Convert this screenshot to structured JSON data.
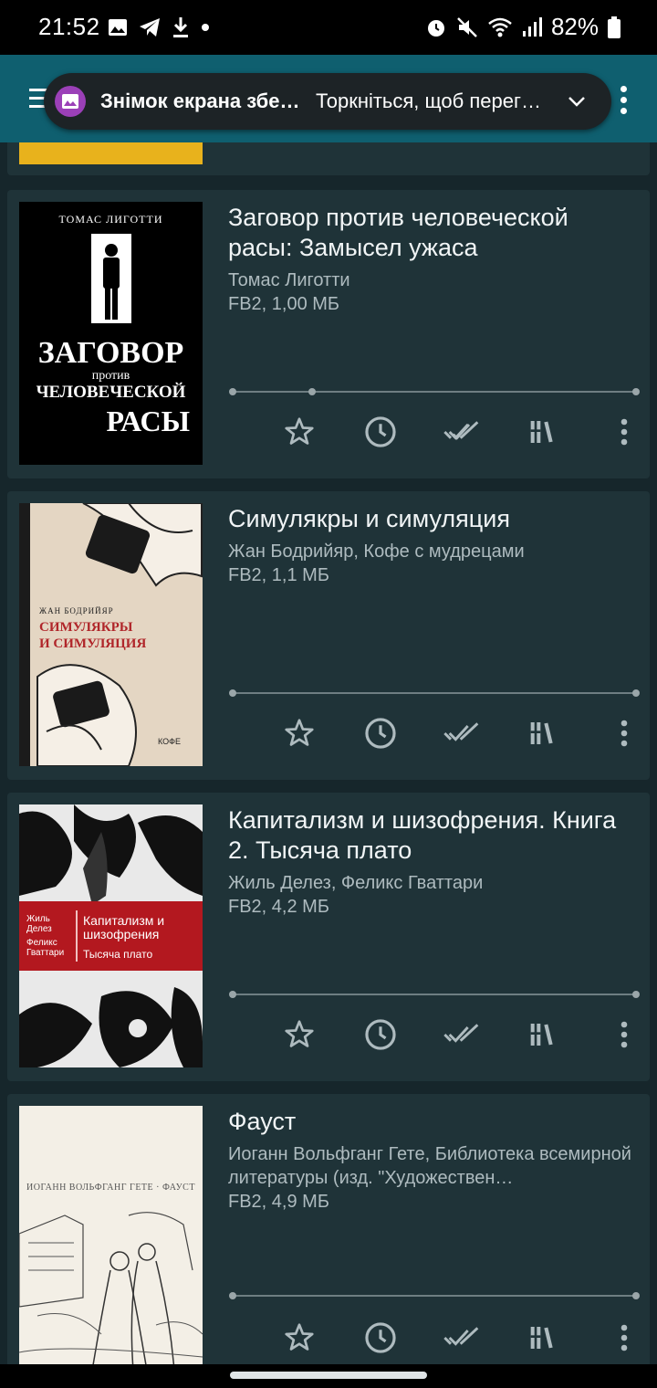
{
  "status_bar": {
    "time": "21:52",
    "battery": "82%",
    "icons": [
      "image-icon",
      "telegram-icon",
      "download-icon",
      "dot-icon",
      "alarm-icon",
      "mute-icon",
      "wifi-icon",
      "signal-icon",
      "battery-icon"
    ]
  },
  "notification": {
    "title": "Знімок екрана збе…",
    "message": "Торкніться, щоб перег…"
  },
  "books": [
    {
      "title": "Заговор против человеческой расы: Замысел ужаса",
      "author": "Томас Лиготти",
      "format": "FB2, 1,00 МБ",
      "cover": {
        "author": "ТОМАС ЛИГОТТИ",
        "line1": "ЗАГОВОР",
        "line2": "против",
        "line3": "ЧЕЛОВЕЧЕСКОЙ",
        "line4": "РАСЫ"
      }
    },
    {
      "title": "Симулякры и симуляция",
      "author": "Жан Бодрийяр, Кофе с мудрецами",
      "format": "FB2, 1,1 МБ",
      "cover": {
        "author": "ЖАН БОДРИЙЯР",
        "line1": "СИМУЛЯКРЫ",
        "line2": "И СИМУЛЯЦИЯ",
        "publisher": "КОФЕ"
      }
    },
    {
      "title": "Капитализм и шизофрения. Книга 2. Тысяча плато",
      "author": "Жиль Делез, Феликс Гваттари",
      "format": "FB2, 4,2 МБ",
      "cover": {
        "author1": "Жиль Делез",
        "author2": "Феликс Гваттари",
        "line1": "Капитализм и шизофрения",
        "line2": "Тысяча плато"
      }
    },
    {
      "title": "Фауст",
      "author": "Иоганн Вольфганг Гете, Библиотека всемирной литературы (изд. \"Художествен…",
      "format": "FB2, 4,9 МБ",
      "cover": {
        "line1": "ИОГАНН ВОЛЬФГАНГ ГЕТЕ · ФАУСТ"
      }
    }
  ],
  "actions": [
    "star-icon",
    "history-icon",
    "done-all-icon",
    "library-icon",
    "more-vert-icon"
  ],
  "colors": {
    "appbar": "#0f5f6f",
    "card": "#1f3338",
    "background": "#16262b",
    "accent_notification": "#9b40b8"
  }
}
